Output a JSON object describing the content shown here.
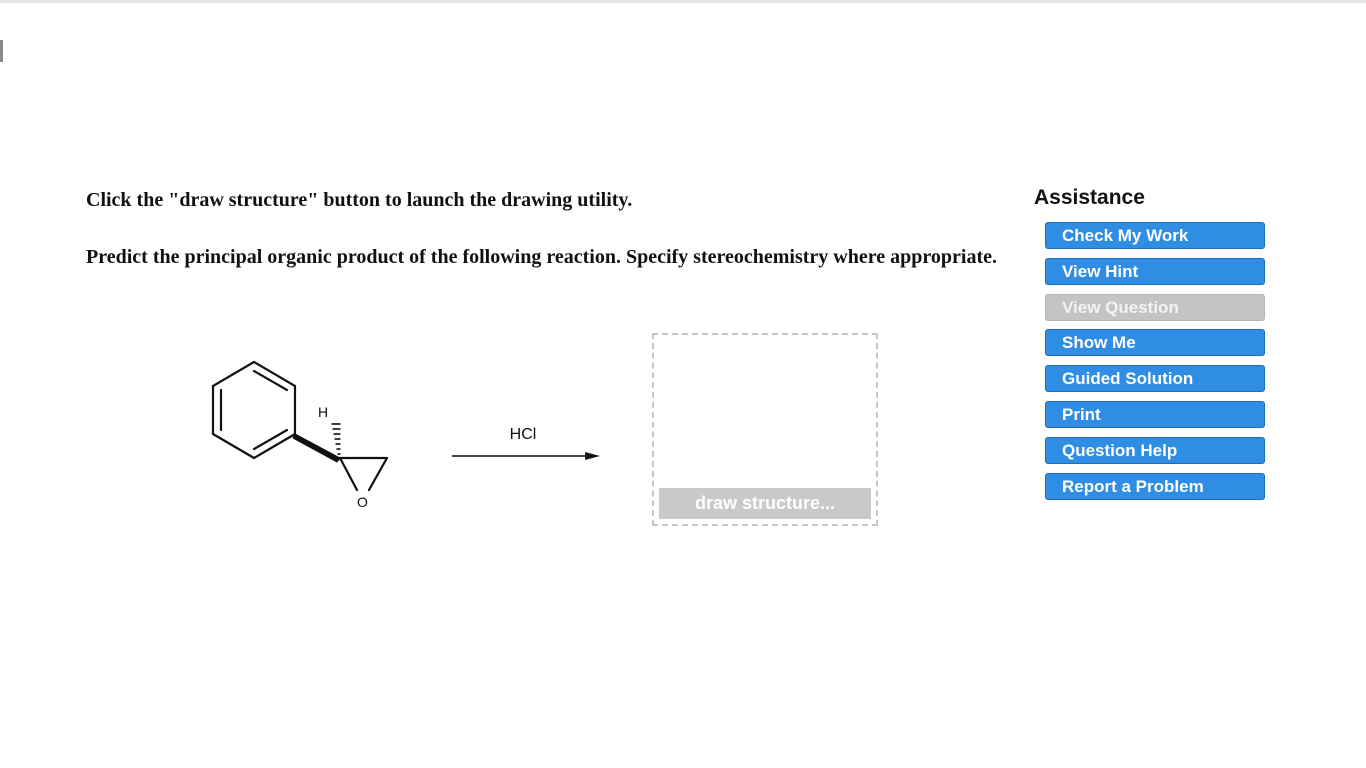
{
  "question": {
    "instruction": "Click the \"draw structure\" button to launch the drawing utility.",
    "prompt": "Predict the principal organic product of the following reaction. Specify stereochemistry where appropriate."
  },
  "reaction": {
    "reagent": "HCl",
    "atom_h": "H",
    "atom_o": "O"
  },
  "answer": {
    "draw_button_label": "draw structure..."
  },
  "assistance": {
    "title": "Assistance",
    "buttons": [
      {
        "label": "Check My Work"
      },
      {
        "label": "View Hint"
      },
      {
        "label": "View Question"
      },
      {
        "label": "Show Me"
      },
      {
        "label": "Guided Solution"
      },
      {
        "label": "Print"
      },
      {
        "label": "Question Help"
      },
      {
        "label": "Report a Problem"
      }
    ]
  }
}
